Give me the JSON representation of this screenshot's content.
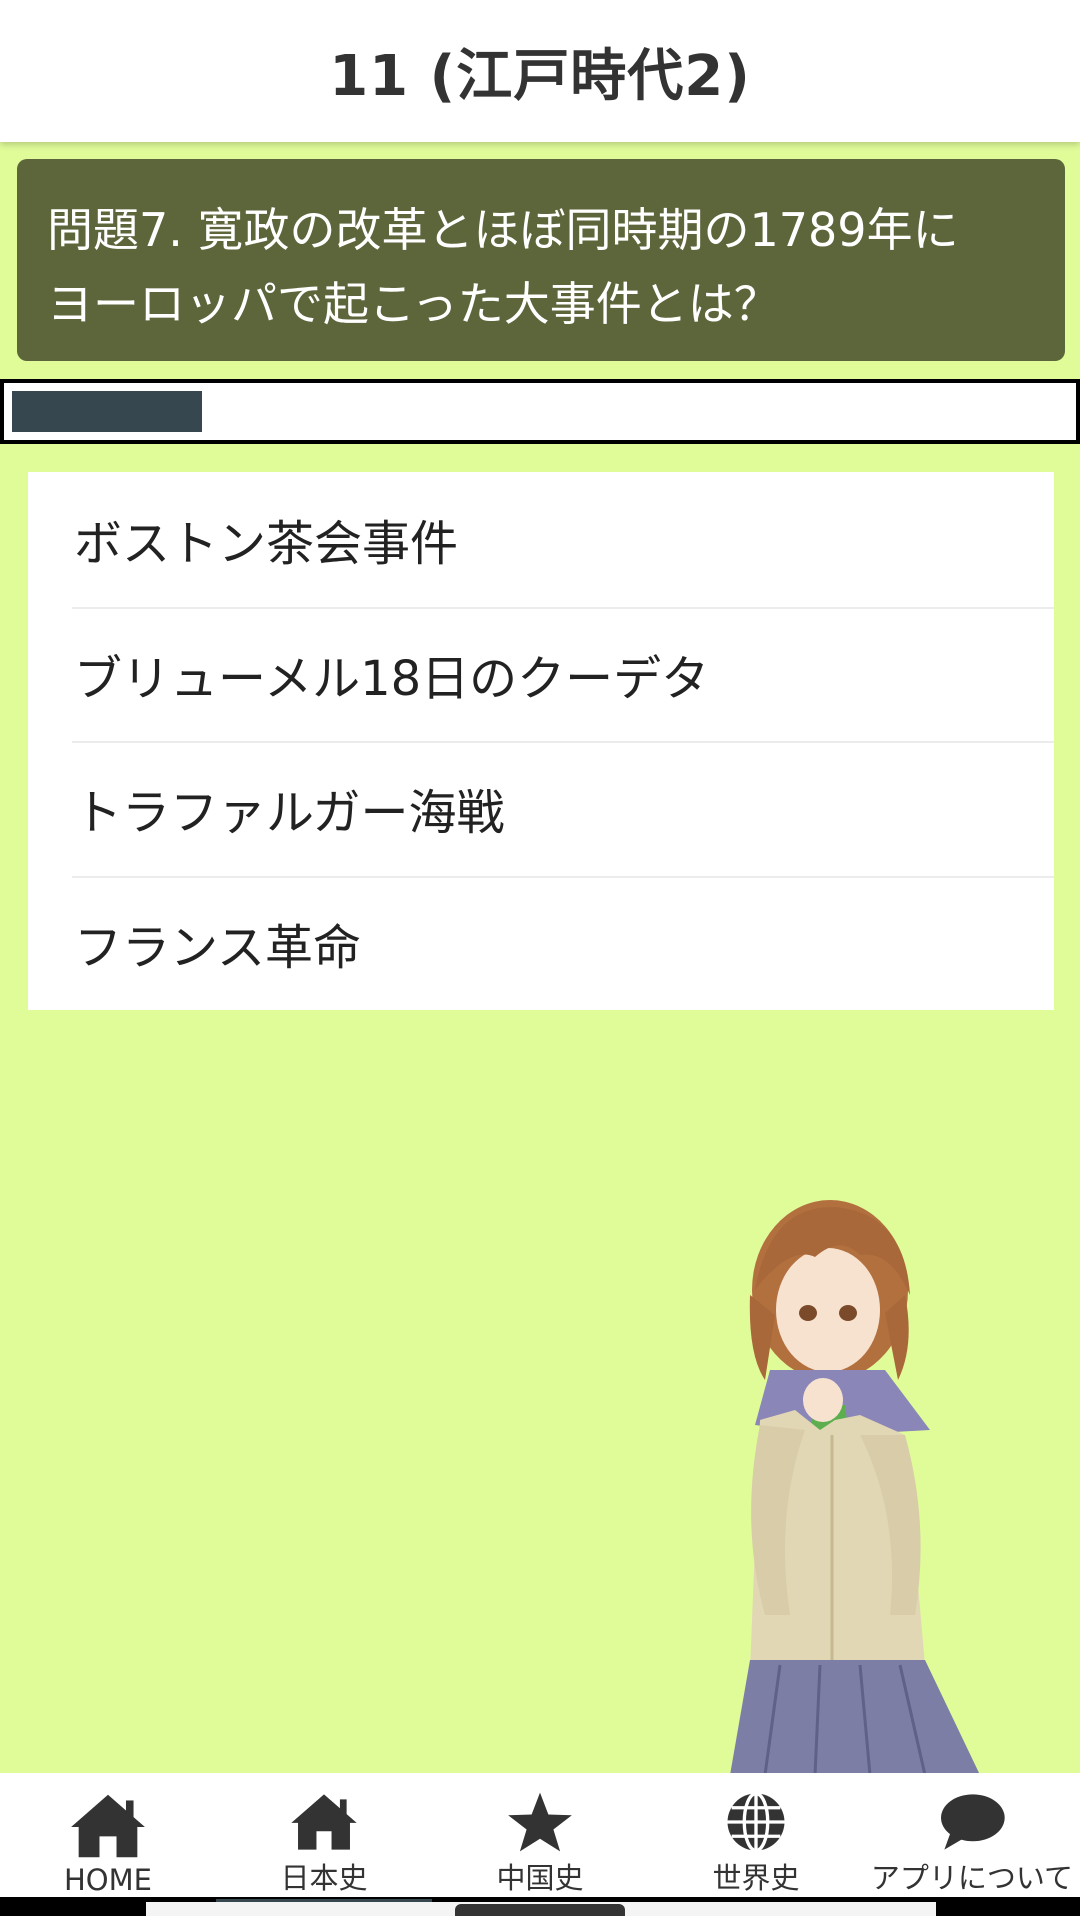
{
  "header": {
    "title": "11 (江戸時代2)"
  },
  "question": {
    "text_line1": "問題7. 寛政の改革とほぼ同時期の1789年に",
    "text_line2": "ヨーロッパで起こった大事件とは？"
  },
  "timer": {
    "remaining_fraction": 0.18
  },
  "answers": [
    {
      "label": "ボストン茶会事件"
    },
    {
      "label": "ブリューメル18日のクーデタ"
    },
    {
      "label": "トラファルガー海戦"
    },
    {
      "label": "フランス革命"
    }
  ],
  "bottom_nav": {
    "items": [
      {
        "label": "HOME",
        "icon": "home-icon"
      },
      {
        "label": "日本史",
        "icon": "home-icon"
      },
      {
        "label": "中国史",
        "icon": "star-icon"
      },
      {
        "label": "世界史",
        "icon": "globe-icon"
      },
      {
        "label": "アプリについて",
        "icon": "speech-bubble-icon"
      }
    ],
    "selected_index": 1
  },
  "colors": {
    "background": "#e0fc99",
    "question_box": "#5d653b",
    "timer_fill": "#37474f",
    "icon": "#333333"
  }
}
